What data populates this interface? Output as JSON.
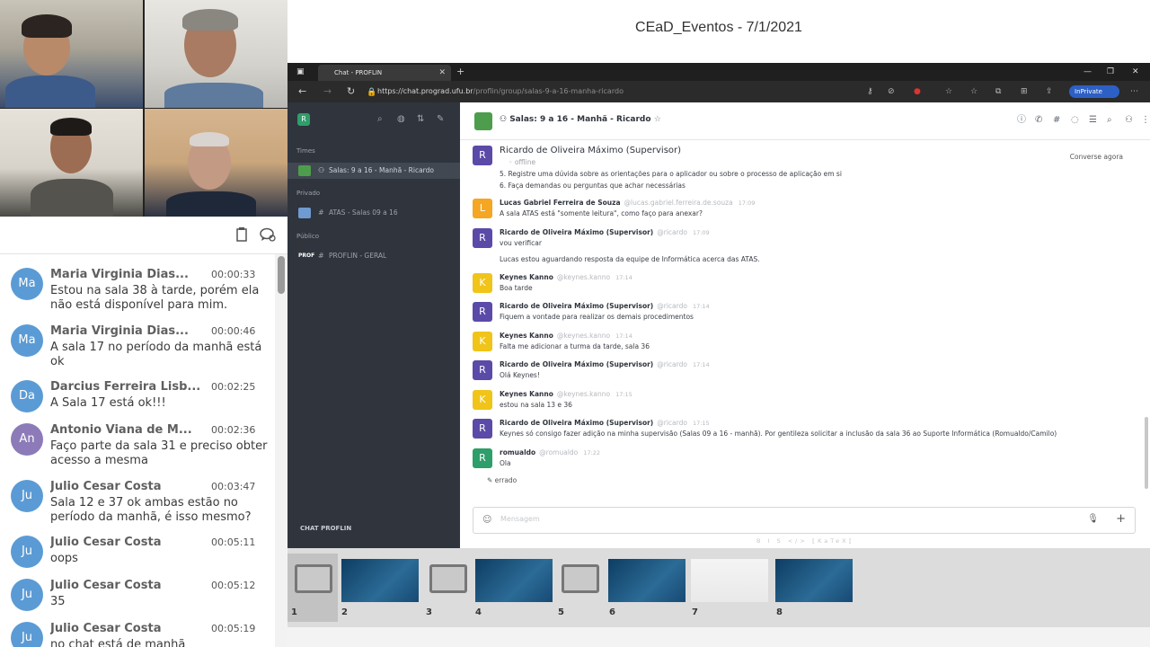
{
  "session": {
    "title": "CEaD_Eventos - 7/1/2021"
  },
  "participants_chat": {
    "messages": [
      {
        "initials": "Ma",
        "color": "#5b9bd5",
        "name": "Maria Virginia Dias...",
        "time": "00:00:33",
        "text": "Estou na sala 38 à tarde, porém ela não está disponível para mim."
      },
      {
        "initials": "Ma",
        "color": "#5b9bd5",
        "name": "Maria Virginia Dias...",
        "time": "00:00:46",
        "text": "A sala 17 no período da manhã está ok"
      },
      {
        "initials": "Da",
        "color": "#5b9bd5",
        "name": "Darcius Ferreira Lisb...",
        "time": "00:02:25",
        "text": "A Sala 17 está ok!!!"
      },
      {
        "initials": "An",
        "color": "#8c7bb8",
        "name": "Antonio Viana de M...",
        "time": "00:02:36",
        "text": "Faço parte da sala 31 e preciso obter acesso a mesma"
      },
      {
        "initials": "Ju",
        "color": "#5b9bd5",
        "name": "Julio Cesar Costa",
        "time": "00:03:47",
        "text": "Sala 12 e 37 ok ambas estão no período da manhã, é isso mesmo?"
      },
      {
        "initials": "Ju",
        "color": "#5b9bd5",
        "name": "Julio Cesar Costa",
        "time": "00:05:11",
        "text": "oops"
      },
      {
        "initials": "Ju",
        "color": "#5b9bd5",
        "name": "Julio Cesar Costa",
        "time": "00:05:12",
        "text": "35"
      },
      {
        "initials": "Ju",
        "color": "#5b9bd5",
        "name": "Julio Cesar Costa",
        "time": "00:05:19",
        "text": "no chat está de manhã"
      }
    ]
  },
  "browser": {
    "tab_title": "Chat - PROFLIN",
    "url_main": "https://chat.prograd.ufu.br",
    "url_rest": "/proflin/group/salas-9-a-16-manha-ricardo",
    "inprivate_label": "InPrivate"
  },
  "rocketchat": {
    "logo": "R",
    "sections": {
      "teams": "Times",
      "private": "Privado",
      "public": "Público"
    },
    "rooms": {
      "team_room": "Salas: 9 a 16 - Manhã - Ricardo",
      "private_room": "ATAS - Salas 09 a 16",
      "public_room": "PROFLIN - GERAL",
      "public_badge": "PROF"
    },
    "brand": "CHAT PROFLIN",
    "header_title": "Salas: 9 a 16 - Manhã - Ricardo",
    "supervisor": {
      "name": "Ricardo de Oliveira Máximo (Supervisor)",
      "status": "offline",
      "converse": "Converse agora",
      "line5": "5. Registre uma dúvida sobre as orientações para o aplicador ou sobre o processo de aplicação em si",
      "line6": "6. Faça demandas ou perguntas que achar necessárias"
    },
    "messages": [
      {
        "initial": "L",
        "color": "#f5a623",
        "user": "Lucas Gabriel Ferreira de Souza",
        "handle": "@lucas.gabriel.ferreira.de.souza",
        "time": "17:09",
        "text": "A sala ATAS está \"somente leitura\", como faço para anexar?"
      },
      {
        "initial": "R",
        "color": "#5b4aa8",
        "user": "Ricardo de Oliveira Máximo (Supervisor)",
        "handle": "@ricardo",
        "time": "17:09",
        "text": "vou verificar",
        "text2": "Lucas estou aguardando resposta da equipe de Informática acerca das ATAS."
      },
      {
        "initial": "K",
        "color": "#f0c419",
        "user": "Keynes Kanno",
        "handle": "@keynes.kanno",
        "time": "17:14",
        "text": "Boa tarde"
      },
      {
        "initial": "R",
        "color": "#5b4aa8",
        "user": "Ricardo de Oliveira Máximo (Supervisor)",
        "handle": "@ricardo",
        "time": "17:14",
        "text": "Fiquem a vontade para realizar os demais procedimentos"
      },
      {
        "initial": "K",
        "color": "#f0c419",
        "user": "Keynes Kanno",
        "handle": "@keynes.kanno",
        "time": "17:14",
        "text": "Falta me adicionar a turma da tarde, sala 36"
      },
      {
        "initial": "R",
        "color": "#5b4aa8",
        "user": "Ricardo de Oliveira Máximo (Supervisor)",
        "handle": "@ricardo",
        "time": "17:14",
        "text": "Olá Keynes!"
      },
      {
        "initial": "K",
        "color": "#f0c419",
        "user": "Keynes Kanno",
        "handle": "@keynes.kanno",
        "time": "17:15",
        "text": "estou na sala 13 e 36"
      },
      {
        "initial": "R",
        "color": "#5b4aa8",
        "user": "Ricardo de Oliveira Máximo (Supervisor)",
        "handle": "@ricardo",
        "time": "17:15",
        "text": "Keynes só consigo fazer adição na minha supervisão (Salas 09 a 16 - manhã). Por gentileza solicitar a inclusão da sala 36 ao Suporte Informática (Romualdo/Camilo)"
      },
      {
        "initial": "R",
        "color": "#2e9e6a",
        "user": "romualdo",
        "handle": "@romualdo",
        "time": "17:22",
        "text": "Ola"
      }
    ],
    "typing_note": "errado",
    "composer_placeholder": "Mensagem",
    "format_hints": "B  I  S  </>  ⟦KaTeX⟧"
  },
  "slides": {
    "items": [
      {
        "num": "1",
        "kind": "monitor",
        "selected": true
      },
      {
        "num": "2",
        "kind": "blue"
      },
      {
        "num": "3",
        "kind": "monitor"
      },
      {
        "num": "4",
        "kind": "blue"
      },
      {
        "num": "5",
        "kind": "monitor"
      },
      {
        "num": "6",
        "kind": "blue"
      },
      {
        "num": "7",
        "kind": "white"
      },
      {
        "num": "8",
        "kind": "blue"
      }
    ]
  }
}
